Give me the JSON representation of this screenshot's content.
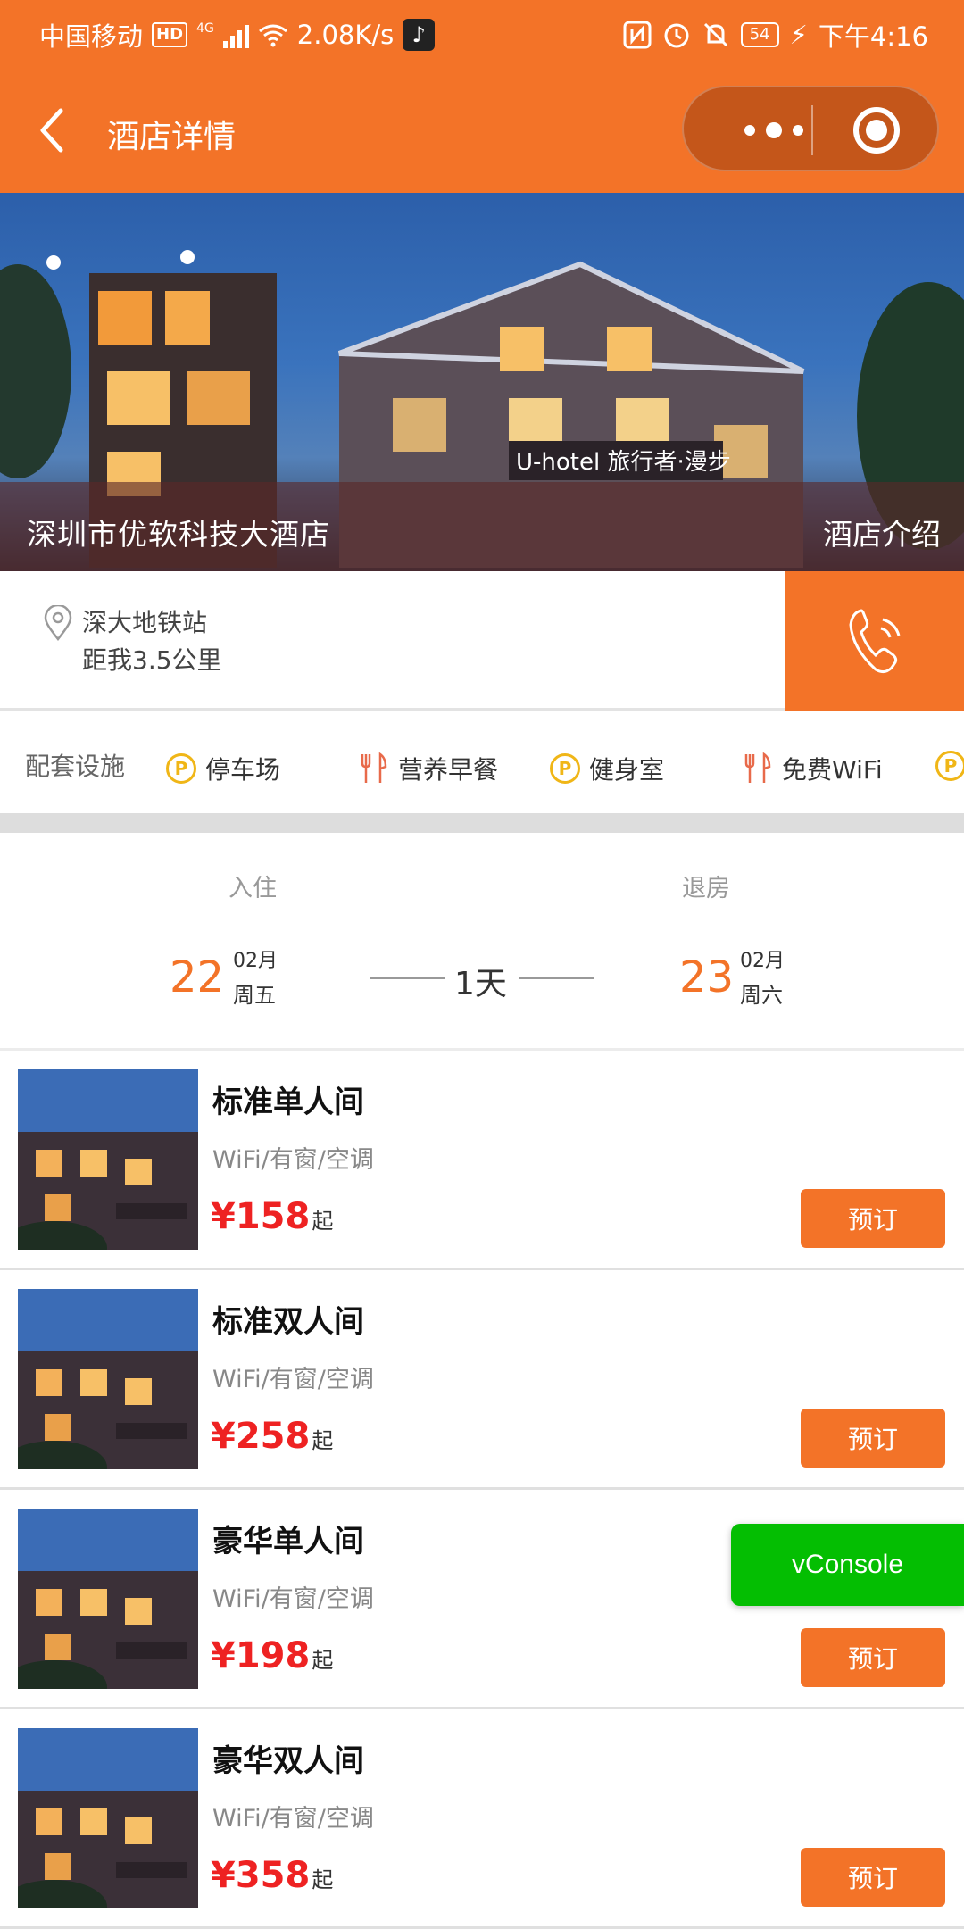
{
  "status_bar": {
    "carrier": "中国移动",
    "hd": "HD",
    "network": "4G",
    "speed": "2.08K/s",
    "battery": "54",
    "time": "下午4:16"
  },
  "nav": {
    "title": "酒店详情"
  },
  "hero": {
    "hotel_name": "深圳市优软科技大酒店",
    "intro_link": "酒店介绍",
    "sign_text": "U-hotel 旅行者·漫步"
  },
  "location": {
    "station": "深大地铁站",
    "distance": "距我3.5公里"
  },
  "facilities": {
    "label": "配套设施",
    "items": [
      {
        "icon": "parking-icon",
        "label": "停车场"
      },
      {
        "icon": "fork-knife-icon",
        "label": "营养早餐"
      },
      {
        "icon": "parking-icon",
        "label": "健身室"
      },
      {
        "icon": "fork-knife-icon",
        "label": "免费WiFi"
      }
    ]
  },
  "dates": {
    "checkin_label": "入住",
    "checkout_label": "退房",
    "checkin_day": "22",
    "checkin_month": "02月",
    "checkin_weekday": "周五",
    "nights": "1天",
    "checkout_day": "23",
    "checkout_month": "02月",
    "checkout_weekday": "周六"
  },
  "rooms": [
    {
      "name": "标准单人间",
      "features": "WiFi/有窗/空调",
      "price": "¥158",
      "suffix": "起",
      "book_label": "预订"
    },
    {
      "name": "标准双人间",
      "features": "WiFi/有窗/空调",
      "price": "¥258",
      "suffix": "起",
      "book_label": "预订"
    },
    {
      "name": "豪华单人间",
      "features": "WiFi/有窗/空调",
      "price": "¥198",
      "suffix": "起",
      "book_label": "预订"
    },
    {
      "name": "豪华双人间",
      "features": "WiFi/有窗/空调",
      "price": "¥358",
      "suffix": "起",
      "book_label": "预订"
    }
  ],
  "vconsole": "vConsole",
  "colors": {
    "brand_orange": "#f37328",
    "price_red": "#ee2222",
    "vconsole_green": "#04be02",
    "parking_yellow": "#f0b617"
  }
}
